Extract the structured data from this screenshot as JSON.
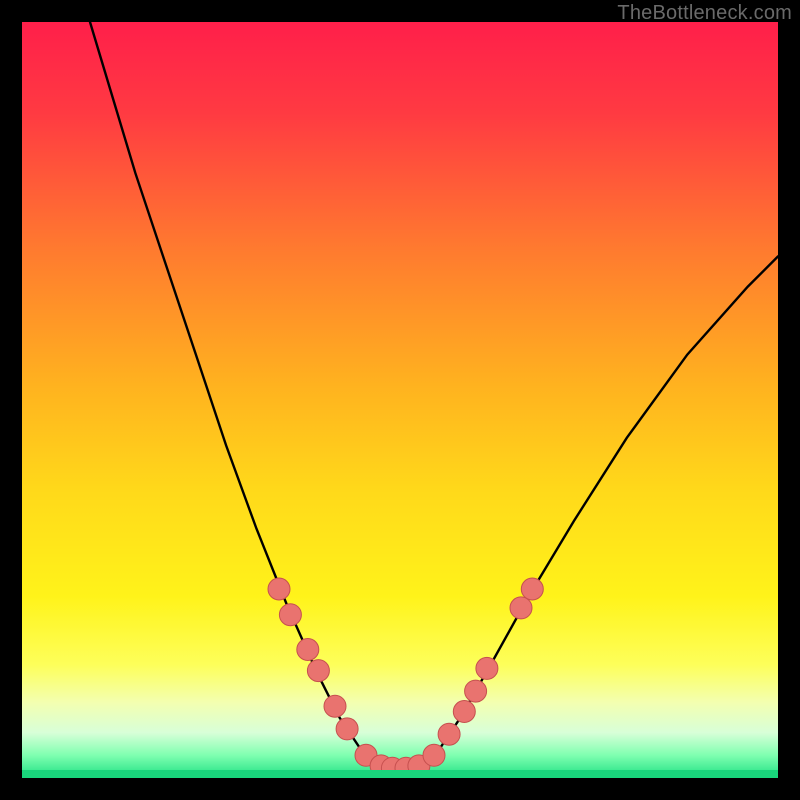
{
  "watermark": "TheBottleneck.com",
  "colors": {
    "dot_fill": "#e9736f",
    "dot_stroke": "#c6504f",
    "curve_stroke": "#000000",
    "frame_bg": "#000000",
    "gradient_stops": [
      {
        "offset": "0%",
        "color": "#ff1f4a"
      },
      {
        "offset": "12%",
        "color": "#ff3a42"
      },
      {
        "offset": "30%",
        "color": "#ff7a2f"
      },
      {
        "offset": "48%",
        "color": "#ffb21f"
      },
      {
        "offset": "62%",
        "color": "#ffd91a"
      },
      {
        "offset": "76%",
        "color": "#fff31a"
      },
      {
        "offset": "85%",
        "color": "#fdff5a"
      },
      {
        "offset": "90%",
        "color": "#f3ffb0"
      },
      {
        "offset": "94%",
        "color": "#d8ffd8"
      },
      {
        "offset": "97%",
        "color": "#7fffb0"
      },
      {
        "offset": "100%",
        "color": "#1ee084"
      }
    ]
  },
  "chart_data": {
    "type": "line",
    "title": "",
    "xlabel": "",
    "ylabel": "",
    "xlim": [
      0,
      100
    ],
    "ylim": [
      0,
      100
    ],
    "series": [
      {
        "name": "curve",
        "points": [
          {
            "x": 9,
            "y": 100
          },
          {
            "x": 12,
            "y": 90
          },
          {
            "x": 15,
            "y": 80
          },
          {
            "x": 19,
            "y": 68
          },
          {
            "x": 23,
            "y": 56
          },
          {
            "x": 27,
            "y": 44
          },
          {
            "x": 31,
            "y": 33
          },
          {
            "x": 35,
            "y": 23
          },
          {
            "x": 39,
            "y": 14
          },
          {
            "x": 42,
            "y": 8
          },
          {
            "x": 45,
            "y": 3.5
          },
          {
            "x": 48,
            "y": 1.5
          },
          {
            "x": 50,
            "y": 1.2
          },
          {
            "x": 52,
            "y": 1.5
          },
          {
            "x": 55,
            "y": 3.5
          },
          {
            "x": 58,
            "y": 8
          },
          {
            "x": 62,
            "y": 15
          },
          {
            "x": 67,
            "y": 24
          },
          {
            "x": 73,
            "y": 34
          },
          {
            "x": 80,
            "y": 45
          },
          {
            "x": 88,
            "y": 56
          },
          {
            "x": 96,
            "y": 65
          },
          {
            "x": 100,
            "y": 69
          }
        ]
      }
    ],
    "markers": [
      {
        "x": 34.0,
        "y": 25.0
      },
      {
        "x": 35.5,
        "y": 21.6
      },
      {
        "x": 37.8,
        "y": 17.0
      },
      {
        "x": 39.2,
        "y": 14.2
      },
      {
        "x": 41.4,
        "y": 9.5
      },
      {
        "x": 43.0,
        "y": 6.5
      },
      {
        "x": 45.5,
        "y": 3.0
      },
      {
        "x": 47.5,
        "y": 1.6
      },
      {
        "x": 49.0,
        "y": 1.3
      },
      {
        "x": 50.8,
        "y": 1.3
      },
      {
        "x": 52.5,
        "y": 1.6
      },
      {
        "x": 54.5,
        "y": 3.0
      },
      {
        "x": 56.5,
        "y": 5.8
      },
      {
        "x": 58.5,
        "y": 8.8
      },
      {
        "x": 60.0,
        "y": 11.5
      },
      {
        "x": 61.5,
        "y": 14.5
      },
      {
        "x": 66.0,
        "y": 22.5
      },
      {
        "x": 67.5,
        "y": 25.0
      }
    ],
    "marker_radius_px": 11
  }
}
